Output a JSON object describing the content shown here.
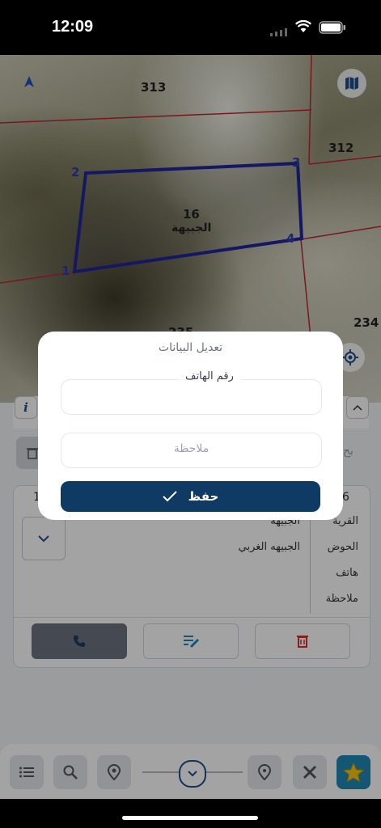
{
  "status_bar": {
    "time": "12:09"
  },
  "map": {
    "parcels": {
      "p313": "313",
      "p312": "312",
      "p16": "16",
      "p235": "235",
      "p234": "234"
    },
    "area_name": "الجبيهة",
    "vertices": [
      "1",
      "2",
      "3",
      "4"
    ],
    "colors": {
      "polygon": "#22259a",
      "boundary": "#c0242b"
    }
  },
  "panel": {
    "left_tab_fragment": "1",
    "right_tab_fragment": "6",
    "search_fragment": "بح",
    "rows": [
      {
        "label": "القرية",
        "value": "الجبيهه"
      },
      {
        "label": "الحوض",
        "value": "الجبيهه الغربي"
      },
      {
        "label": "هاتف",
        "value": ""
      },
      {
        "label": "ملاحظة",
        "value": ""
      }
    ]
  },
  "modal": {
    "title": "تعديل البيانات",
    "phone_label": "رقم الهاتف",
    "phone_value": "",
    "note_placeholder": "ملاحظة",
    "save_label": "حفظ"
  },
  "colors": {
    "primary": "#0e3a63",
    "danger": "#d32f2f",
    "accent_star": "#1e88b8"
  }
}
